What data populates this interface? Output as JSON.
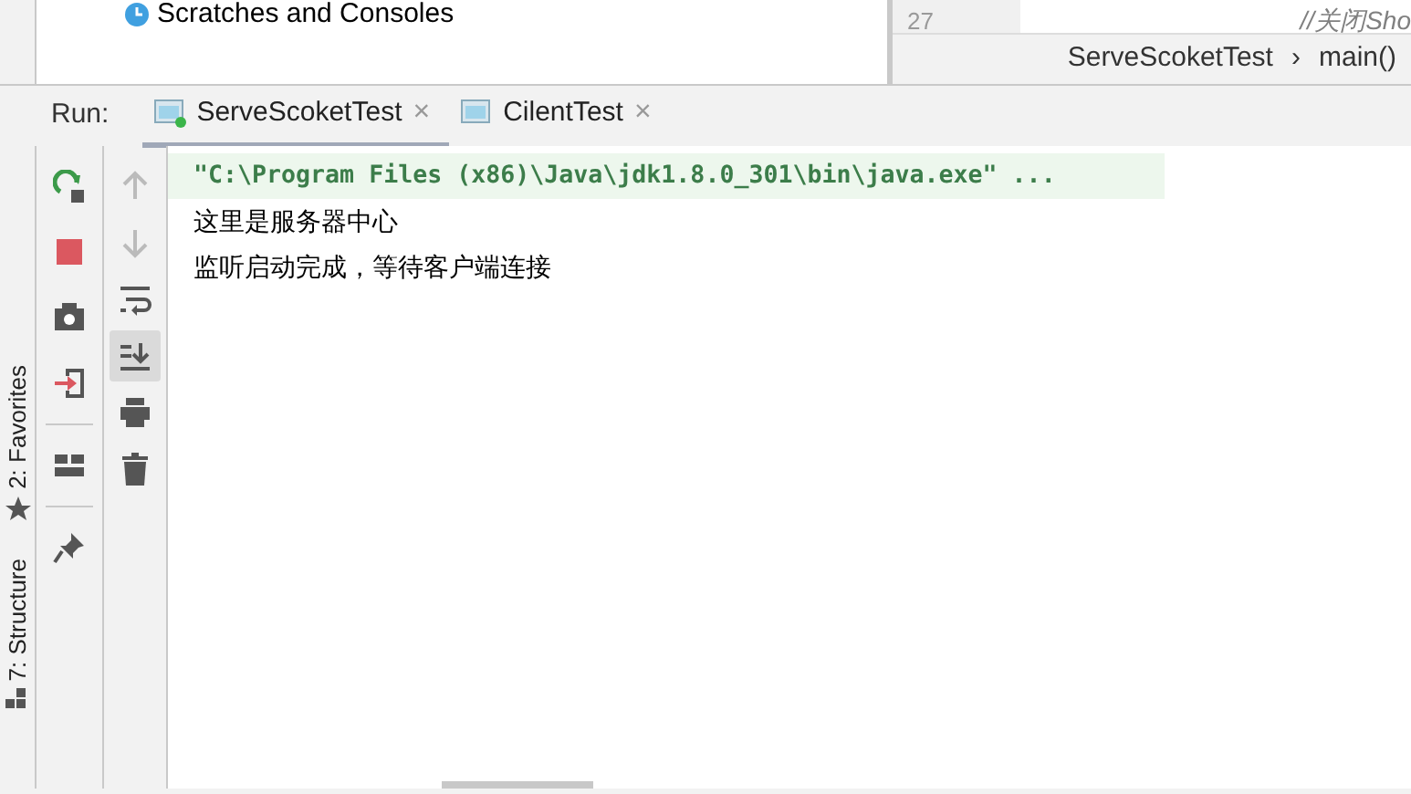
{
  "project_tree": {
    "items": [
      {
        "label": "Scratches and Consoles"
      }
    ]
  },
  "editor": {
    "line_number": "27",
    "code": "//关闭Sho",
    "breadcrumbs": [
      "ServeScoketTest",
      "›",
      "main()"
    ]
  },
  "side_strip": [
    {
      "label": "2: Favorites",
      "kind": "star"
    },
    {
      "label": "7: Structure",
      "kind": "structure"
    }
  ],
  "run_panel": {
    "label": "Run:",
    "tabs": [
      {
        "label": "ServeScoketTest",
        "selected": true,
        "running": true,
        "close": "×"
      },
      {
        "label": "CilentTest",
        "selected": false,
        "running": false,
        "close": "×"
      }
    ]
  },
  "run_toolbar": [
    {
      "kind": "rerun"
    },
    {
      "kind": "stop"
    },
    {
      "kind": "camera"
    },
    {
      "kind": "exit"
    },
    {
      "kind": "sep"
    },
    {
      "kind": "layout"
    },
    {
      "kind": "sep"
    },
    {
      "kind": "pin"
    }
  ],
  "console_toolbar": [
    {
      "kind": "up",
      "disabled": true,
      "on": false
    },
    {
      "kind": "down",
      "disabled": true,
      "on": false
    },
    {
      "kind": "wrap",
      "disabled": false,
      "on": false
    },
    {
      "kind": "scroll-end",
      "disabled": false,
      "on": true
    },
    {
      "kind": "print",
      "disabled": false,
      "on": false
    },
    {
      "kind": "trash",
      "disabled": false,
      "on": false
    }
  ],
  "console": [
    {
      "kind": "command",
      "text": "\"C:\\Program Files (x86)\\Java\\jdk1.8.0_301\\bin\\java.exe\" ..."
    },
    {
      "kind": "output",
      "text": "这里是服务器中心"
    },
    {
      "kind": "output",
      "text": "监听启动完成，等待客户端连接"
    }
  ]
}
